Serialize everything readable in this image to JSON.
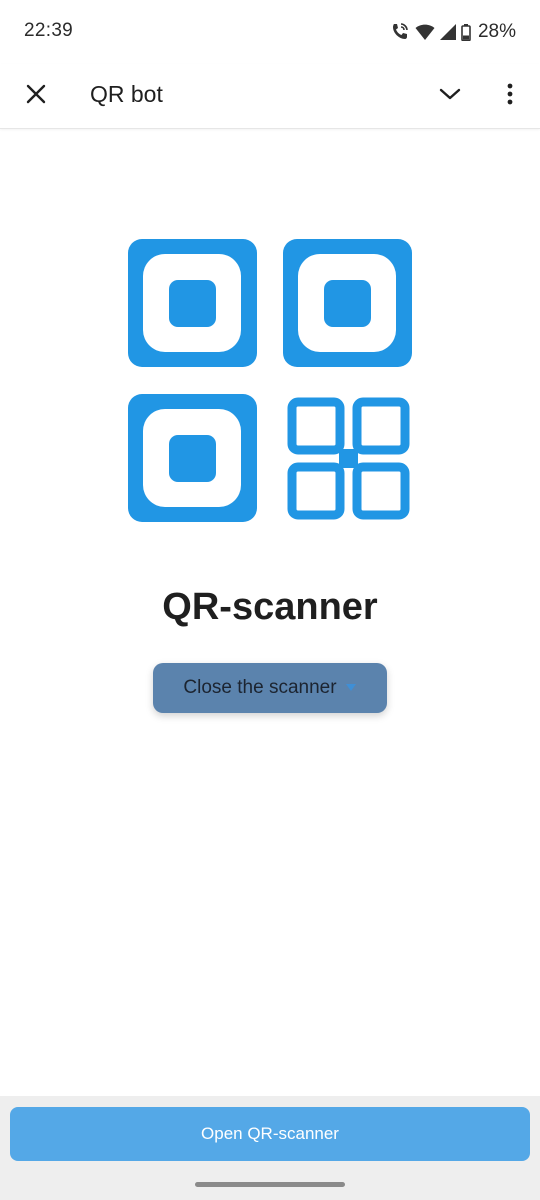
{
  "status_bar": {
    "time": "22:39",
    "battery": "28%",
    "icons": [
      "wifi-calling-icon",
      "wifi-icon",
      "signal-icon",
      "battery-icon"
    ]
  },
  "header": {
    "title": "QR bot",
    "close_icon": "close-icon",
    "chevron_icon": "chevron-down-icon",
    "more_icon": "more-vertical-icon"
  },
  "main": {
    "logo_icon": "qr-code-icon",
    "heading": "QR-scanner",
    "close_button_label": "Close the scanner"
  },
  "footer": {
    "open_button_label": "Open QR-scanner"
  },
  "colors": {
    "accent": "#2196e4",
    "main_button": "#54a8e7",
    "close_button": "#5b83ad"
  }
}
